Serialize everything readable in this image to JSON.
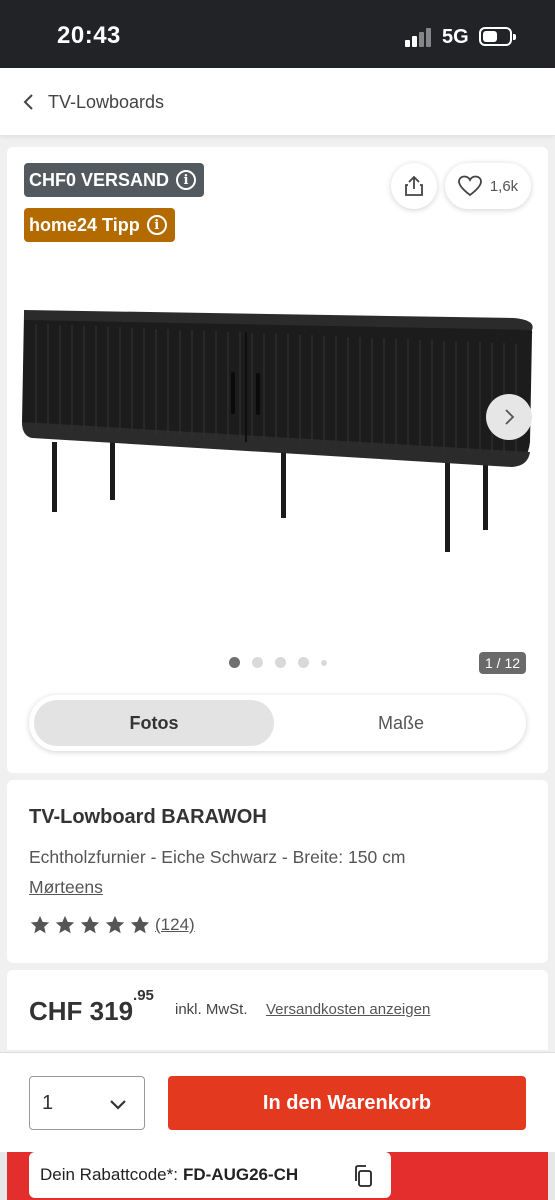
{
  "status_bar": {
    "time": "20:43",
    "network": "5G"
  },
  "header": {
    "back_label": "TV-Lowboards"
  },
  "gallery": {
    "badge_shipping": "CHF0 VERSAND",
    "badge_tipp": "home24 Tipp",
    "info_glyph": "i",
    "favorite_count": "1,6k",
    "page_counter": "1 / 12",
    "current_image": 1,
    "tab_photos": "Fotos",
    "tab_dimensions": "Maße",
    "colors": {
      "shipping_badge": "#525a5f",
      "tipp_badge": "#b36b00"
    }
  },
  "product": {
    "title": "TV-Lowboard BARAWOH",
    "subtitle": "Echtholzfurnier - Eiche Schwarz - Breite: 150 cm",
    "brand": "Mørteens",
    "rating_stars": 5,
    "review_count": "(124)"
  },
  "price": {
    "currency_main": "CHF 319",
    "cents": ".95",
    "vat_note": "inkl. MwSt.",
    "shipping_link": "Versandkosten anzeigen"
  },
  "cart": {
    "quantity": "1",
    "add_button": "In den Warenkorb",
    "button_color": "#e33a1f"
  },
  "promo": {
    "label": "Dein Rabattcode*:",
    "code": "FD-AUG26-CH",
    "banner_color": "#e42d2d"
  },
  "icons": [
    "back-chevron-icon",
    "share-icon",
    "heart-icon",
    "info-icon",
    "chevron-right-icon",
    "star-icon",
    "chevron-down-icon",
    "copy-icon"
  ]
}
